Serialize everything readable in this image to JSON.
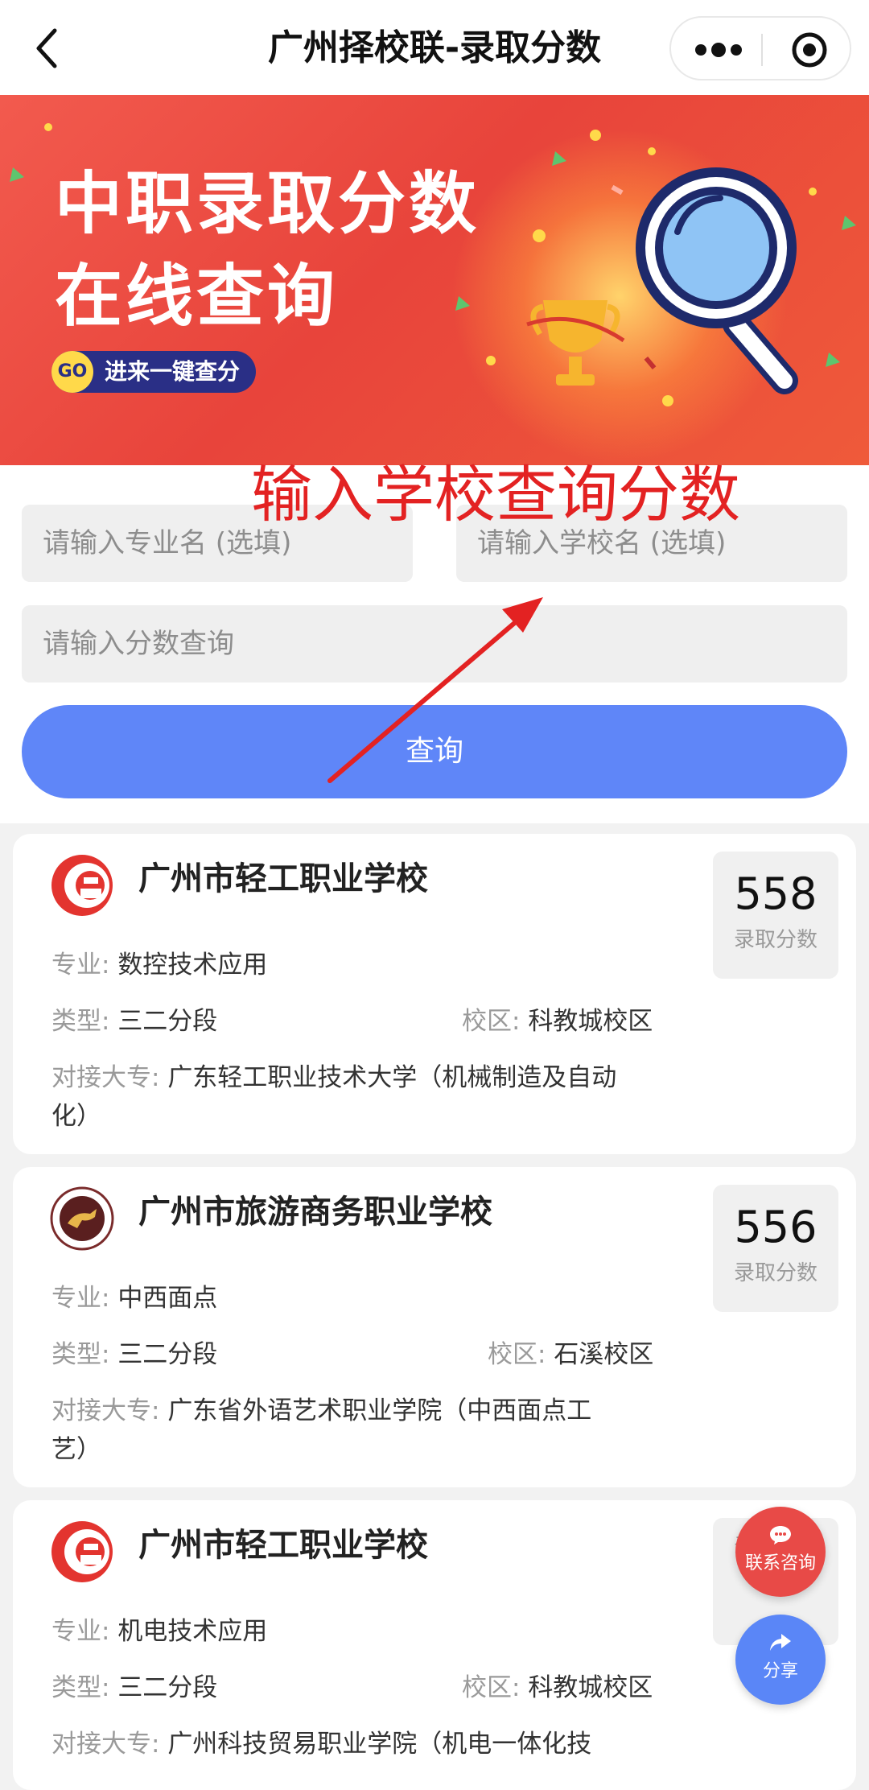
{
  "nav": {
    "title": "广州择校联-录取分数"
  },
  "banner": {
    "headline_1": "中职录取分数",
    "headline_2": "在线查询",
    "go_badge": "GO",
    "cta": "进来一键查分"
  },
  "annotation": "输入学校查询分数",
  "form": {
    "major_placeholder": "请输入专业名 (选填)",
    "school_placeholder": "请输入学校名 (选填)",
    "score_placeholder": "请输入分数查询",
    "query_button": "查询"
  },
  "labels": {
    "major": "专业:",
    "type": "类型:",
    "campus": "校区:",
    "partner": "对接大专:",
    "score": "录取分数"
  },
  "results": [
    {
      "school": "广州市轻工职业学校",
      "score": "558",
      "major": "数控技术应用",
      "type": "三二分段",
      "campus": "科教城校区",
      "partner_line1": "广东轻工职业技术大学（机械制造及自动",
      "partner_line2": "化）"
    },
    {
      "school": "广州市旅游商务职业学校",
      "score": "556",
      "major": "中西面点",
      "type": "三二分段",
      "campus": "石溪校区",
      "partner_line1": "广东省外语艺术职业学院（中西面点工",
      "partner_line2": "艺）"
    },
    {
      "school": "广州市轻工职业学校",
      "score": "",
      "major": "机电技术应用",
      "type": "三二分段",
      "campus": "科教城校区",
      "partner_line1": "广州科技贸易职业学院（机电一体化技",
      "partner_line2": ""
    }
  ],
  "fab": {
    "consult": "联系咨询",
    "share": "分享"
  },
  "colors": {
    "primary_button": "#5f86f8",
    "banner_red": "#e8443b",
    "annotation_red": "#e32222",
    "consult_fab": "#e84a47",
    "share_fab": "#5a86f7"
  }
}
